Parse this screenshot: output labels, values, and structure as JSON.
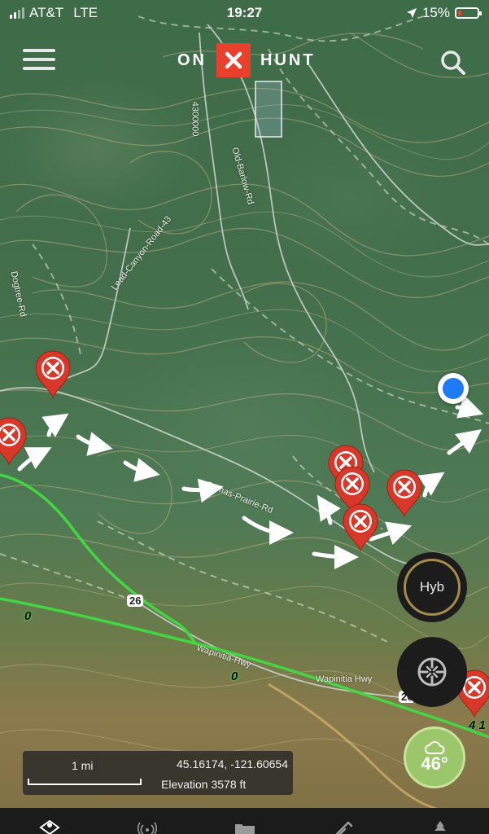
{
  "status_bar": {
    "carrier": "AT&T",
    "network": "LTE",
    "time": "19:27",
    "battery": "15%",
    "battery_color": "#ff3b30"
  },
  "header": {
    "logo_left": "ON",
    "logo_right": "HUNT",
    "logo_color": "#e8402c",
    "menu_icon": "hamburger-icon",
    "search_icon": "search-icon"
  },
  "map": {
    "road_labels": {
      "r1": "4300000",
      "r2": "Old-Barlow-Rd",
      "r3": "Lead-Canyon-Road-43",
      "r4": "Dogtree-Rd",
      "r5": "Camas-Prairie-Rd",
      "r6": "Wapinitia-Hwy",
      "r7": "Wapinitia Hwy"
    },
    "highway_shields": {
      "h1": "26",
      "h2": "26"
    },
    "zero_labels": [
      "0",
      "0"
    ],
    "corner_label": "4 1",
    "route_color": "#42d742",
    "pin_color": "#d8382a"
  },
  "controls": {
    "layer_button": "Hyb",
    "locate_icon": "compass-target-icon",
    "weather_icon": "cloud-icon",
    "temperature": "46°",
    "weather_color": "#9cc66a"
  },
  "scale_panel": {
    "scale": "1 mi",
    "coordinates": "45.16174, -121.60654",
    "elevation": "Elevation 3578 ft"
  },
  "bottom_nav": {
    "items": [
      "map-icon",
      "tracker-icon",
      "folder-icon",
      "tools-icon",
      "forest-icon"
    ]
  }
}
